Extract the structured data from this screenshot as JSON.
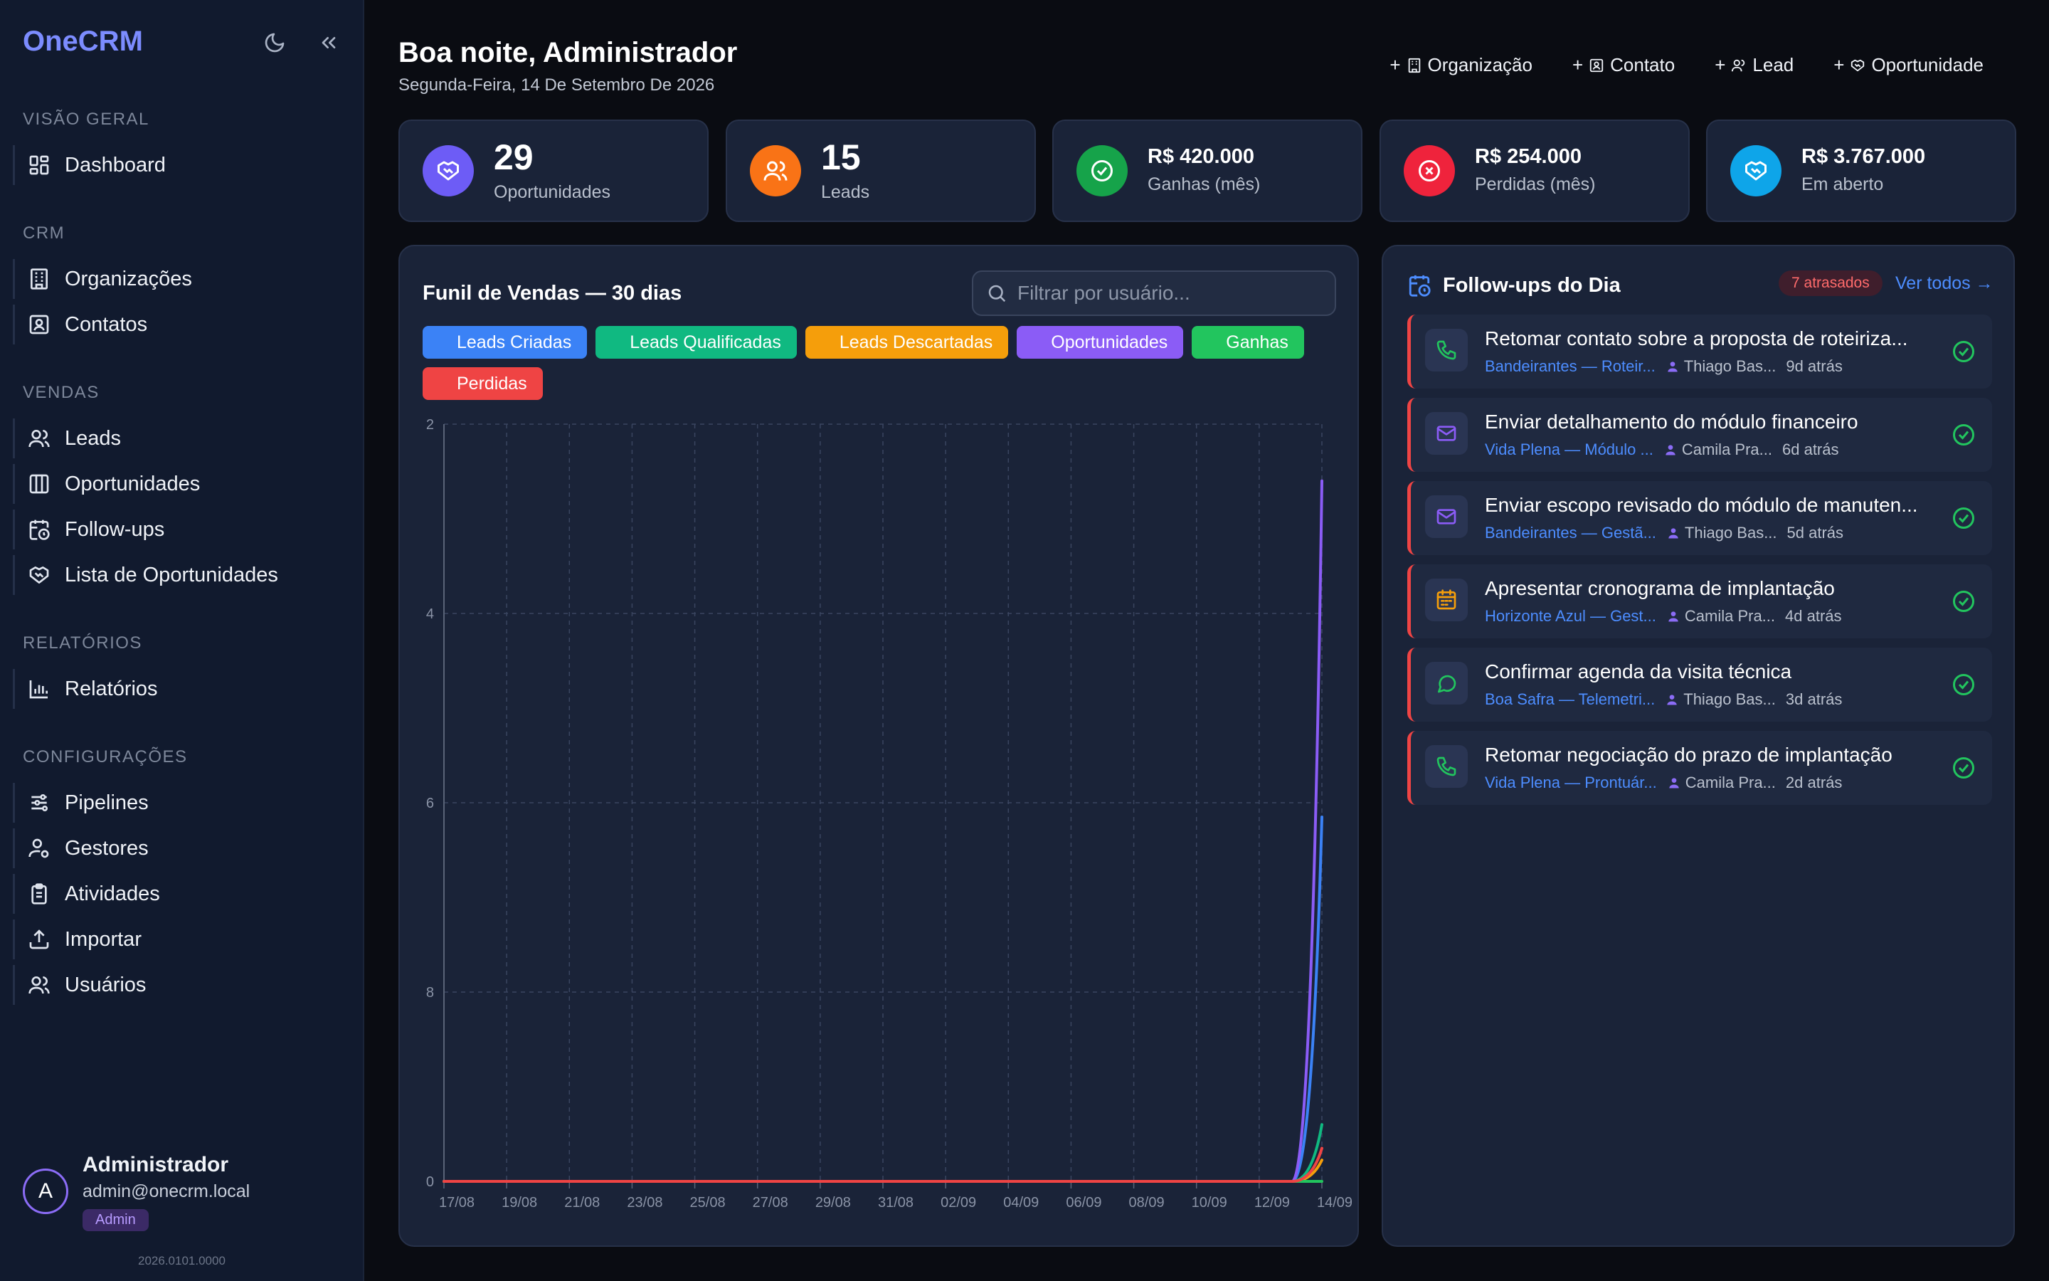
{
  "app": {
    "logo": "OneCRM",
    "version": "2026.0101.0000"
  },
  "sidebar": {
    "sections": [
      {
        "title": "VISÃO GERAL",
        "items": [
          {
            "label": "Dashboard",
            "icon": "dashboard-icon"
          }
        ]
      },
      {
        "title": "CRM",
        "items": [
          {
            "label": "Organizações",
            "icon": "building-icon"
          },
          {
            "label": "Contatos",
            "icon": "contact-card-icon"
          }
        ]
      },
      {
        "title": "VENDAS",
        "items": [
          {
            "label": "Leads",
            "icon": "users-icon"
          },
          {
            "label": "Oportunidades",
            "icon": "kanban-icon"
          },
          {
            "label": "Follow-ups",
            "icon": "calendar-clock-icon"
          },
          {
            "label": "Lista de Oportunidades",
            "icon": "handshake-icon"
          }
        ]
      },
      {
        "title": "RELATÓRIOS",
        "items": [
          {
            "label": "Relatórios",
            "icon": "bar-chart-icon"
          }
        ]
      },
      {
        "title": "CONFIGURAÇÕES",
        "items": [
          {
            "label": "Pipelines",
            "icon": "sliders-icon"
          },
          {
            "label": "Gestores",
            "icon": "user-cog-icon"
          },
          {
            "label": "Atividades",
            "icon": "clipboard-icon"
          },
          {
            "label": "Importar",
            "icon": "upload-icon"
          },
          {
            "label": "Usuários",
            "icon": "users-icon"
          }
        ]
      }
    ],
    "user": {
      "initial": "A",
      "name": "Administrador",
      "email": "admin@onecrm.local",
      "role": "Admin"
    }
  },
  "header": {
    "greeting": "Boa noite, Administrador",
    "date": "Segunda-Feira, 14 De Setembro De 2026",
    "quick_actions": [
      {
        "label": "Organização",
        "icon": "building-icon"
      },
      {
        "label": "Contato",
        "icon": "contact-card-icon"
      },
      {
        "label": "Lead",
        "icon": "users-icon"
      },
      {
        "label": "Oportunidade",
        "icon": "handshake-icon"
      }
    ]
  },
  "kpis": [
    {
      "value": "29",
      "label": "Oportunidades",
      "color": "#6d5cf6",
      "icon": "handshake-icon"
    },
    {
      "value": "15",
      "label": "Leads",
      "color": "#f97316",
      "icon": "users-icon"
    },
    {
      "value": "R$ 420.000",
      "label": "Ganhas (mês)",
      "color": "#16a34a",
      "icon": "check-circle-icon"
    },
    {
      "value": "R$ 254.000",
      "label": "Perdidas (mês)",
      "color": "#ef233c",
      "icon": "x-circle-icon"
    },
    {
      "value": "R$ 3.767.000",
      "label": "Em aberto",
      "color": "#0ea5e9",
      "icon": "handshake-icon"
    }
  ],
  "chart": {
    "title": "Funil de Vendas — 30 dias",
    "search_placeholder": "Filtrar por usuário..."
  },
  "chart_data": {
    "type": "line",
    "x": [
      "17/08",
      "19/08",
      "21/08",
      "23/08",
      "25/08",
      "27/08",
      "29/08",
      "31/08",
      "02/09",
      "04/09",
      "06/09",
      "08/09",
      "10/09",
      "12/09",
      "14/09"
    ],
    "y_tick_labels": [
      "2",
      "4",
      "6",
      "8",
      "0"
    ],
    "grid": true,
    "legend_position": "top",
    "series": [
      {
        "name": "Leads Criadas",
        "color": "#3b82f6",
        "end_value": 7.7
      },
      {
        "name": "Leads Qualificadas",
        "color": "#10b981",
        "end_value": 1.2
      },
      {
        "name": "Leads Descartadas",
        "color": "#f59e0b",
        "end_value": 0.45
      },
      {
        "name": "Oportunidades",
        "color": "#8b5cf6",
        "end_value": 14.8
      },
      {
        "name": "Ganhas",
        "color": "#22c55e",
        "end_value": 0
      },
      {
        "name": "Perdidas",
        "color": "#ef4444",
        "end_value": 0.7
      }
    ]
  },
  "followups": {
    "title": "Follow-ups do Dia",
    "overdue": "7 atrasados",
    "see_all": "Ver todos →",
    "items": [
      {
        "type_icon": "phone-icon",
        "type_color": "#22c55e",
        "subject": "Retomar contato sobre a proposta de roteiriza...",
        "org": "Bandeirantes — Roteir...",
        "user": "Thiago Bas...",
        "when": "9d atrás"
      },
      {
        "type_icon": "mail-icon",
        "type_color": "#8b5cf6",
        "subject": "Enviar detalhamento do módulo financeiro",
        "org": "Vida Plena — Módulo ...",
        "user": "Camila Pra...",
        "when": "6d atrás"
      },
      {
        "type_icon": "mail-icon",
        "type_color": "#8b5cf6",
        "subject": "Enviar escopo revisado do módulo de manuten...",
        "org": "Bandeirantes — Gestã...",
        "user": "Thiago Bas...",
        "when": "5d atrás"
      },
      {
        "type_icon": "calendar-icon",
        "type_color": "#f59e0b",
        "subject": "Apresentar cronograma de implantação",
        "org": "Horizonte Azul — Gest...",
        "user": "Camila Pra...",
        "when": "4d atrás"
      },
      {
        "type_icon": "chat-icon",
        "type_color": "#22c55e",
        "subject": "Confirmar agenda da visita técnica",
        "org": "Boa Safra — Telemetri...",
        "user": "Thiago Bas...",
        "when": "3d atrás"
      },
      {
        "type_icon": "phone-icon",
        "type_color": "#22c55e",
        "subject": "Retomar negociação do prazo de implantação",
        "org": "Vida Plena — Prontuár...",
        "user": "Camila Pra...",
        "when": "2d atrás"
      }
    ]
  }
}
